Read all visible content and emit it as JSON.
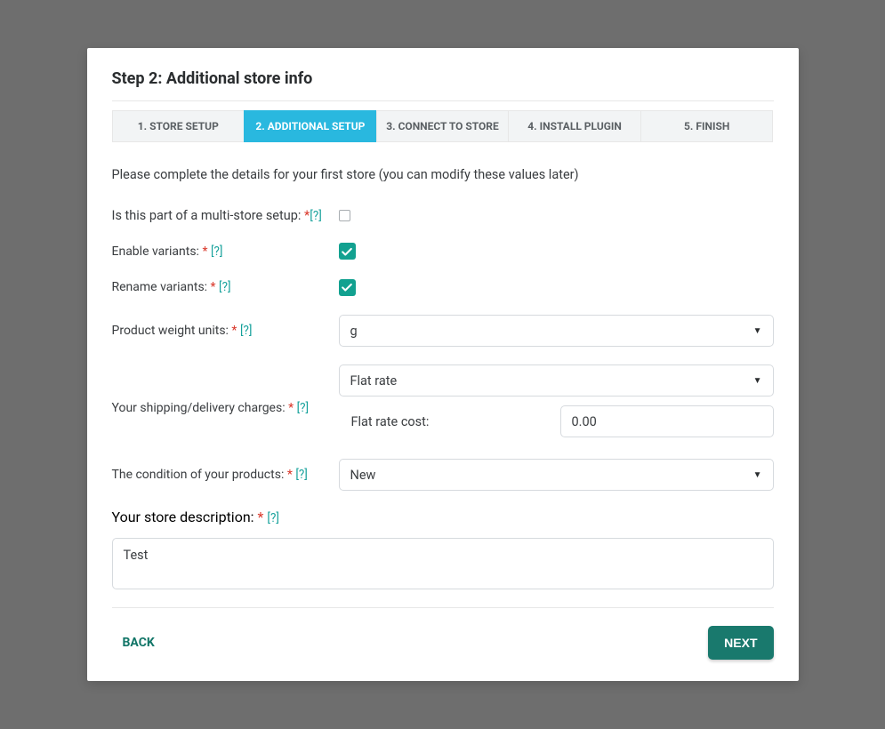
{
  "title": "Step 2: Additional store info",
  "tabs": [
    {
      "label": "1. STORE SETUP"
    },
    {
      "label": "2. ADDITIONAL SETUP"
    },
    {
      "label": "3. CONNECT TO STORE"
    },
    {
      "label": "4. INSTALL PLUGIN"
    },
    {
      "label": "5. FINISH"
    }
  ],
  "intro": "Please complete the details for your first store (you can modify these values later)",
  "labels": {
    "multistore": "Is this part of a multi-store setup: ",
    "enable_variants": "Enable variants: ",
    "rename_variants": "Rename variants: ",
    "weight_units": "Product weight units: ",
    "shipping": "Your shipping/delivery charges: ",
    "flat_rate_cost": "Flat rate cost:",
    "condition": "The condition of your products: ",
    "description": "Your store description: "
  },
  "help": "[?]",
  "req": "*",
  "values": {
    "weight_units": "g",
    "shipping_type": "Flat rate",
    "flat_rate_cost": "0.00",
    "condition": "New",
    "description": "Test"
  },
  "buttons": {
    "back": "BACK",
    "next": "NEXT"
  }
}
